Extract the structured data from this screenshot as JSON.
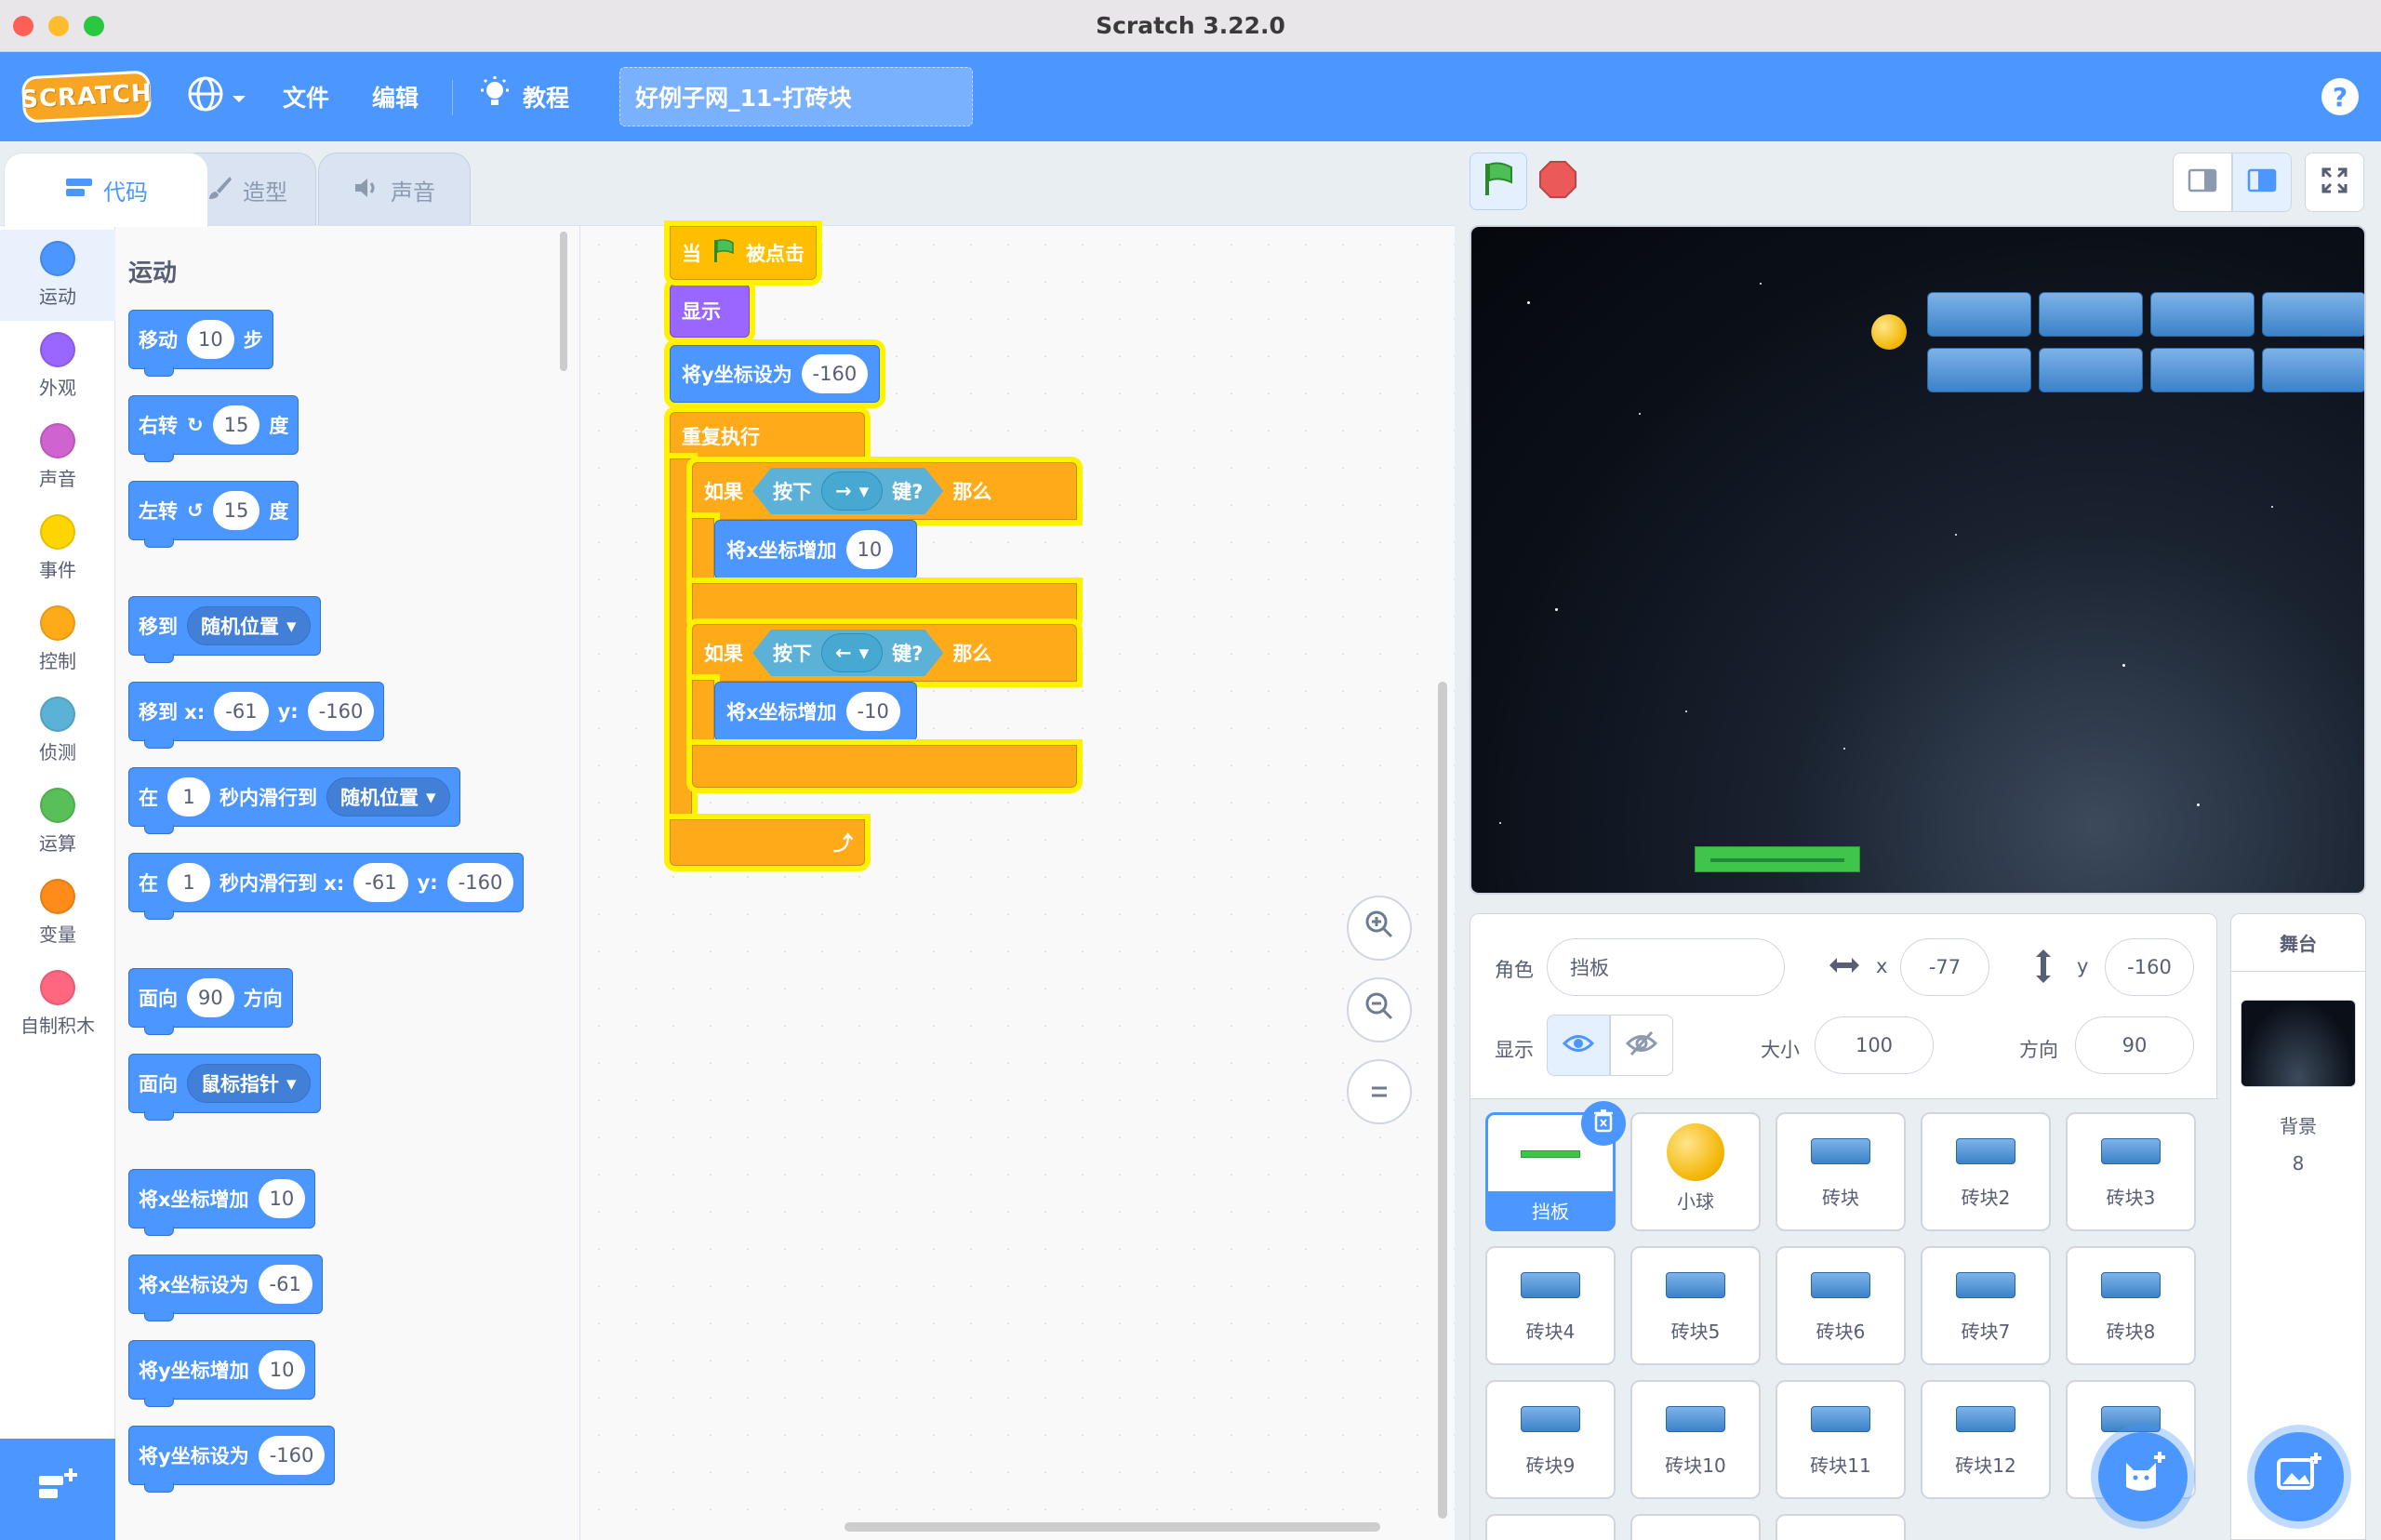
{
  "window": {
    "title": "Scratch 3.22.0"
  },
  "menubar": {
    "logo": "SCRATCH",
    "file": "文件",
    "edit": "编辑",
    "tutorials": "教程",
    "project_title": "好例子网_11-打砖块",
    "help": "?"
  },
  "tabs": [
    {
      "label": "代码"
    },
    {
      "label": "造型"
    },
    {
      "label": "声音"
    }
  ],
  "categories": [
    {
      "label": "运动",
      "color": "#4c97ff"
    },
    {
      "label": "外观",
      "color": "#9966ff"
    },
    {
      "label": "声音",
      "color": "#cf63cf"
    },
    {
      "label": "事件",
      "color": "#ffd500"
    },
    {
      "label": "控制",
      "color": "#ffab19"
    },
    {
      "label": "侦测",
      "color": "#5cb1d6"
    },
    {
      "label": "运算",
      "color": "#59c059"
    },
    {
      "label": "变量",
      "color": "#ff8c1a"
    },
    {
      "label": "自制积木",
      "color": "#ff6680"
    }
  ],
  "palette": {
    "section_title": "运动",
    "move": {
      "a": "移动",
      "v": "10",
      "b": "步"
    },
    "turn_right": {
      "a": "右转",
      "v": "15",
      "b": "度"
    },
    "turn_left": {
      "a": "左转",
      "v": "15",
      "b": "度"
    },
    "goto": {
      "a": "移到",
      "dd": "随机位置"
    },
    "goto_xy": {
      "a": "移到 x:",
      "x": "-61",
      "yl": "y:",
      "y": "-160"
    },
    "glide": {
      "a": "在",
      "v": "1",
      "b": "秒内滑行到",
      "dd": "随机位置"
    },
    "glide_xy": {
      "a": "在",
      "v": "1",
      "b": "秒内滑行到 x:",
      "x": "-61",
      "yl": "y:",
      "y": "-160"
    },
    "point_dir": {
      "a": "面向",
      "v": "90",
      "b": "方向"
    },
    "point_towards": {
      "a": "面向",
      "dd": "鼠标指针"
    },
    "change_x": {
      "a": "将x坐标增加",
      "v": "10"
    },
    "set_x": {
      "a": "将x坐标设为",
      "v": "-61"
    },
    "change_y": {
      "a": "将y坐标增加",
      "v": "10"
    },
    "set_y": {
      "a": "将y坐标设为",
      "v": "-160"
    }
  },
  "script": {
    "hat": {
      "a": "当",
      "b": "被点击"
    },
    "show": "显示",
    "set_y": {
      "a": "将y坐标设为",
      "v": "-160"
    },
    "forever": "重复执行",
    "if1": {
      "a": "如果",
      "press": "按下",
      "key": "→",
      "q": "键?",
      "then": "那么"
    },
    "change_x1": {
      "a": "将x坐标增加",
      "v": "10"
    },
    "if2": {
      "a": "如果",
      "press": "按下",
      "key": "←",
      "q": "键?",
      "then": "那么"
    },
    "change_x2": {
      "a": "将x坐标增加",
      "v": "-10"
    }
  },
  "sprite_info": {
    "sprite_label": "角色",
    "sprite_name": "挡板",
    "x_label": "x",
    "x": "-77",
    "y_label": "y",
    "y": "-160",
    "show_label": "显示",
    "size_label": "大小",
    "size": "100",
    "direction_label": "方向",
    "direction": "90"
  },
  "sprites": [
    {
      "name": "挡板"
    },
    {
      "name": "小球"
    },
    {
      "name": "砖块"
    },
    {
      "name": "砖块2"
    },
    {
      "name": "砖块3"
    },
    {
      "name": "砖块4"
    },
    {
      "name": "砖块5"
    },
    {
      "name": "砖块6"
    },
    {
      "name": "砖块7"
    },
    {
      "name": "砖块8"
    },
    {
      "name": "砖块9"
    },
    {
      "name": "砖块10"
    },
    {
      "name": "砖块11"
    },
    {
      "name": "砖块12"
    },
    {
      "name": ""
    }
  ],
  "stage_panel": {
    "title": "舞台",
    "backdrop_label": "背景",
    "backdrop_count": "8"
  }
}
